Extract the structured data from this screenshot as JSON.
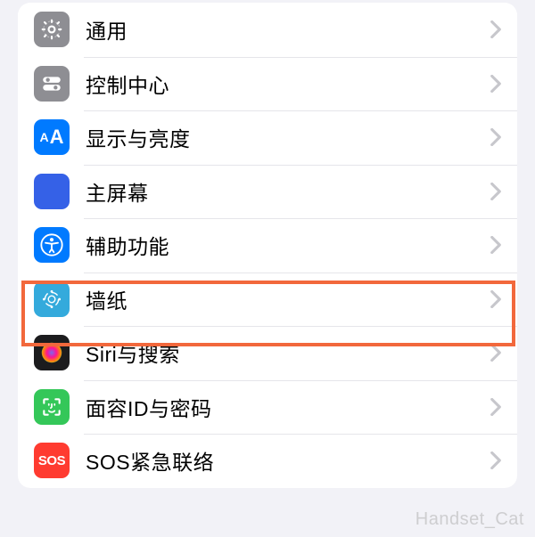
{
  "settings": {
    "items": [
      {
        "label": "通用",
        "icon": "gear-icon"
      },
      {
        "label": "控制中心",
        "icon": "toggles-icon"
      },
      {
        "label": "显示与亮度",
        "icon": "text-size-icon"
      },
      {
        "label": "主屏幕",
        "icon": "home-grid-icon"
      },
      {
        "label": "辅助功能",
        "icon": "accessibility-icon"
      },
      {
        "label": "墙纸",
        "icon": "wallpaper-icon"
      },
      {
        "label": "Siri与搜索",
        "icon": "siri-icon"
      },
      {
        "label": "面容ID与密码",
        "icon": "faceid-icon"
      },
      {
        "label": "SOS紧急联络",
        "icon": "sos-icon",
        "icon_text": "SOS"
      }
    ]
  },
  "highlighted_index": 5,
  "watermark": "Handset_Cat"
}
